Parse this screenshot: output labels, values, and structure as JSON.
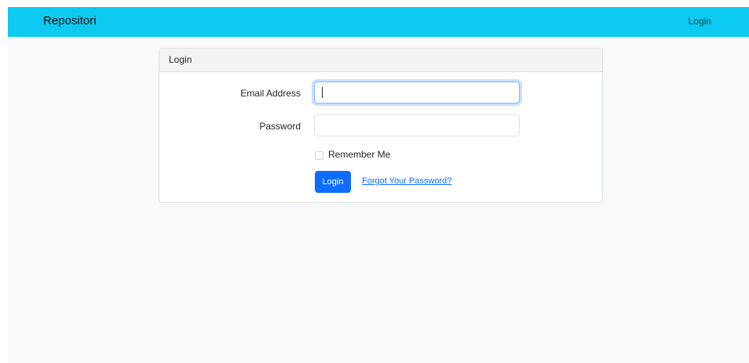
{
  "navbar": {
    "brand": "Repositori",
    "login_link": "Login",
    "bg_color": "#0dcaf0"
  },
  "card": {
    "header": "Login",
    "email": {
      "label": "Email Address",
      "value": "",
      "focused": true
    },
    "password": {
      "label": "Password",
      "value": ""
    },
    "remember": {
      "label": "Remember Me",
      "checked": false
    },
    "submit_label": "Login",
    "forgot_link": "Forgot Your Password?",
    "accent_color": "#0d6efd"
  }
}
